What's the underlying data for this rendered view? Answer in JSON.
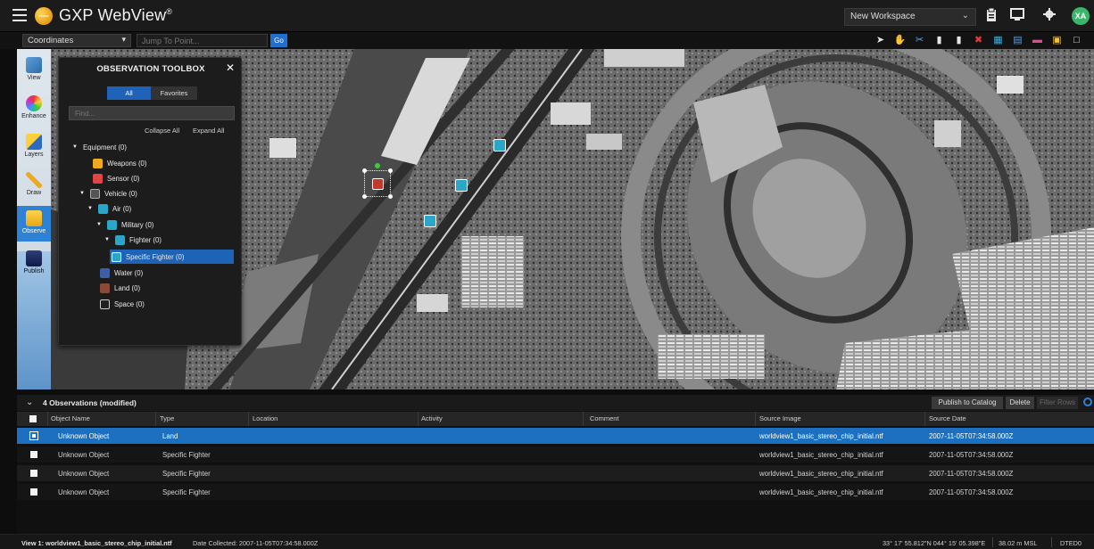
{
  "header": {
    "app_title": "GXP WebView",
    "app_title_mark": "®",
    "workspace": "New Workspace",
    "user_initials": "XA"
  },
  "navbar": {
    "coordinate_system": "Coordinates",
    "jump_placeholder": "Jump To Point...",
    "go_label": "Go"
  },
  "left_rail": {
    "items": [
      {
        "label": "View"
      },
      {
        "label": "Enhance"
      },
      {
        "label": "Layers"
      },
      {
        "label": "Draw"
      },
      {
        "label": "Observe"
      },
      {
        "label": "Publish"
      }
    ]
  },
  "toolbox": {
    "title": "OBSERVATION TOOLBOX",
    "tabs": [
      {
        "label": "All"
      },
      {
        "label": "Favorites"
      }
    ],
    "find_placeholder": "Find...",
    "collapse_all": "Collapse All",
    "expand_all": "Expand All",
    "tree": [
      {
        "label": "Equipment (0)"
      },
      {
        "label": "Weapons (0)"
      },
      {
        "label": "Sensor (0)"
      },
      {
        "label": "Vehicle (0)"
      },
      {
        "label": "Air (0)"
      },
      {
        "label": "Military (0)"
      },
      {
        "label": "Fighter (0)"
      },
      {
        "label": "Specific Fighter (0)"
      },
      {
        "label": "Water (0)"
      },
      {
        "label": "Land (0)"
      },
      {
        "label": "Space (0)"
      }
    ]
  },
  "observations": {
    "summary": "4 Observations (modified)",
    "publish_label": "Publish to Catalog",
    "delete_label": "Delete",
    "filter_label": "Filter Rows",
    "columns": [
      "Object Name",
      "Type",
      "Location",
      "Activity",
      "Comment",
      "Source Image",
      "Source Date"
    ],
    "rows": [
      {
        "name": "Unknown Object",
        "type": "Land",
        "location": "",
        "activity": "",
        "comment": "",
        "source_image": "worldview1_basic_stereo_chip_initial.ntf",
        "source_date": "2007-11-05T07:34:58.000Z"
      },
      {
        "name": "Unknown Object",
        "type": "Specific Fighter",
        "location": "",
        "activity": "",
        "comment": "",
        "source_image": "worldview1_basic_stereo_chip_initial.ntf",
        "source_date": "2007-11-05T07:34:58.000Z"
      },
      {
        "name": "Unknown Object",
        "type": "Specific Fighter",
        "location": "",
        "activity": "",
        "comment": "",
        "source_image": "worldview1_basic_stereo_chip_initial.ntf",
        "source_date": "2007-11-05T07:34:58.000Z"
      },
      {
        "name": "Unknown Object",
        "type": "Specific Fighter",
        "location": "",
        "activity": "",
        "comment": "",
        "source_image": "worldview1_basic_stereo_chip_initial.ntf",
        "source_date": "2007-11-05T07:34:58.000Z"
      }
    ]
  },
  "status": {
    "view": "View 1: worldview1_basic_stereo_chip_initial.ntf",
    "date_collected": "Date Collected: 2007-11-05T07:34:58.000Z",
    "coordinates": "33° 17' 55.812\"N 044° 15' 05.398\"E",
    "elevation": "38.02 m MSL",
    "dted": "DTED0"
  },
  "colors": {
    "accent": "#1e63b8",
    "selection": "#1d6fc0",
    "avatar": "#38b76a",
    "go_button": "#1f6fd0"
  },
  "icons": {
    "top_right": [
      "clipboard-icon",
      "monitor-icon",
      "gear-icon"
    ],
    "toolbar": [
      "arrow-pointer-icon",
      "pan-hand-icon",
      "cut-icon",
      "copy-icon",
      "paste-icon",
      "delete-x-icon",
      "grid-icon",
      "layers-icon",
      "flag-icon",
      "image-icon",
      "window-icon"
    ],
    "tree": [
      "weapons-icon",
      "sensor-icon",
      "vehicle-icon",
      "air-icon",
      "water-icon",
      "land-icon",
      "space-icon"
    ]
  }
}
